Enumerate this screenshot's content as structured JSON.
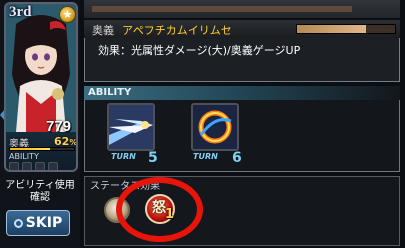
{
  "character": {
    "rank": "3rd",
    "hp": "779",
    "ougi_label": "奥義",
    "ougi_percent": "62",
    "ougi_unit": "%",
    "ougi_fill": 0.62,
    "ability_label": "ABILITY"
  },
  "left_panel": {
    "ability_confirm": "アビリティ使用確認",
    "skip_label": "SKIP"
  },
  "info_panel": {
    "header_label": "奥義",
    "skill_name": "アペフチカムイリムセ",
    "effect_text": "効果：光属性ダメージ(大)/奥義ゲージUP"
  },
  "ability_panel": {
    "label": "ABILITY",
    "abilities": [
      {
        "turn_label": "TURN",
        "turn_value": "5",
        "icon": "blue-arrow-strike-icon"
      },
      {
        "turn_label": "TURN",
        "turn_value": "6",
        "icon": "flame-ring-icon"
      }
    ]
  },
  "status_panel": {
    "label": "ステータス効果",
    "effects": [
      {
        "icon": "status-effect-icon"
      },
      {
        "icon": "fury-buff-icon",
        "glyph": "怒",
        "count": "1"
      }
    ]
  },
  "colors": {
    "accent_gold": "#ffcf2a",
    "turn_blue": "#7fd0f6",
    "highlight_red": "#e8140a"
  }
}
